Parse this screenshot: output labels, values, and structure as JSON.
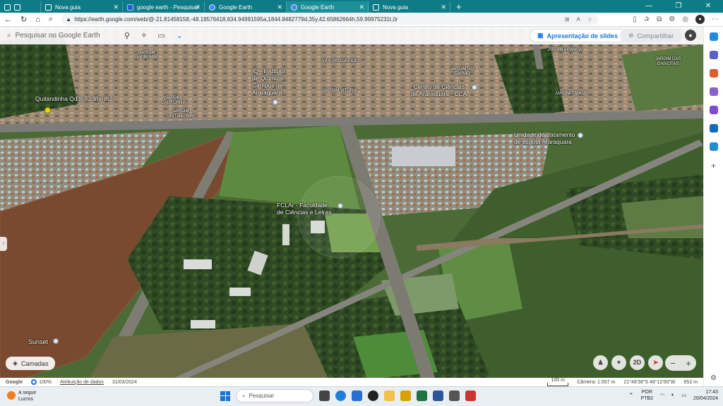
{
  "browser": {
    "tabs": [
      {
        "title": "Nova guia",
        "active": false
      },
      {
        "title": "google earth - Pesquisar",
        "active": false
      },
      {
        "title": "Google Earth",
        "active": false
      },
      {
        "title": "Google Earth",
        "active": true
      },
      {
        "title": "Nova guia",
        "active": false
      }
    ],
    "url": "https://earth.google.com/web/@-21.81458158,-48.19576418,634.94991595a,1844.8482779d,35y,42.65862664h,59.99975231t,0r"
  },
  "earth_toolbar": {
    "search_placeholder": "Pesquisar no Google Earth",
    "slides_label": "Apresentação de slides",
    "share_label": "Compartilhar"
  },
  "map_labels": {
    "quitandinha": "Quitandinha Qd B - 23mil m2",
    "iq": "IQ - Instituto\nde Química -\nCampus de\nAraraquara",
    "cca": "Centro de Ciências\nde Araraquara - CCA",
    "ete": "Unidade de tratamento\nde esgoto Araraquara",
    "fclar": "FCLAr - Faculdade\nde Ciências e Letras",
    "sunset": "Sunset",
    "jardim_morumbi": "JARDIM\nMORUMBI",
    "vila_progresso": "VILA PROGRESSO",
    "jardim_aranga": "JARDIM ARANGA",
    "jardim_gaivotas": "JARDIM DAS\nGAIVOTAS",
    "jardim_carmo": "JARDIM DO\nCARMO",
    "jardim_vitoria": "JARDIM VITÓRIA",
    "jardim_tamoio": "JARDIM TAMOIO",
    "jardim_california": "JARDIM\nCALIFÓRNIA",
    "jardim_quitandinha": "JARDIM\nQUITANDINHA"
  },
  "map_controls": {
    "layers_label": "Camadas",
    "mode_2d": "2D"
  },
  "statusbar": {
    "brand": "Google",
    "zoom": "100%",
    "attribution": "Atribuição de dados",
    "date": "31/03/2024",
    "scale": "100 m",
    "camera": "Câmera: 1.557 m",
    "coords": "21°48'38\"S 48°12'00\"W",
    "elevation": "652 m"
  },
  "taskbar": {
    "weather_line1": "A seguir",
    "weather_line2": "Lucros",
    "search_label": "Pesquisar",
    "lang1": "POR",
    "lang2": "PTB2",
    "time": "17:43",
    "date": "20/04/2024"
  },
  "colors": {
    "tabbar": "#0f7b86",
    "accent": "#1a73e8"
  }
}
